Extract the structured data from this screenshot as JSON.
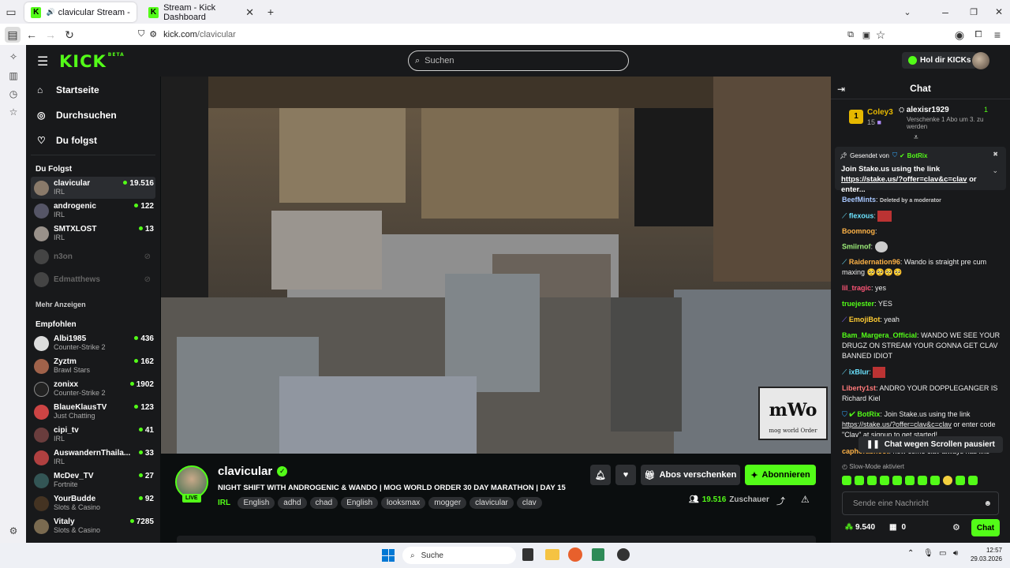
{
  "browser": {
    "tabs": [
      {
        "label": "clavicular Stream - Watch L"
      },
      {
        "label": "Stream - Kick Dashboard"
      }
    ],
    "url_host": "kick.com",
    "url_path": "/clavicular"
  },
  "topbar": {
    "logo": "KICK",
    "logo_badge": "BETA",
    "search_placeholder": "Suchen",
    "promo": "Hol dir KICKs"
  },
  "nav": {
    "items": [
      {
        "label": "Startseite",
        "icon": "home-icon"
      },
      {
        "label": "Durchsuchen",
        "icon": "compass-icon"
      },
      {
        "label": "Du folgst",
        "icon": "heart-icon"
      }
    ]
  },
  "followed": {
    "title": "Du Folgst",
    "more": "Mehr Anzeigen",
    "channels": [
      {
        "name": "clavicular",
        "category": "IRL",
        "viewers": "19.516",
        "selected": true
      },
      {
        "name": "androgenic",
        "category": "IRL",
        "viewers": "122"
      },
      {
        "name": "SMTXLOST",
        "category": "IRL",
        "viewers": "13"
      },
      {
        "name": "n3on",
        "category": "",
        "viewers": "",
        "offline": true
      },
      {
        "name": "Edmatthews",
        "category": "",
        "viewers": "",
        "offline": true
      }
    ]
  },
  "recommended": {
    "title": "Empfohlen",
    "channels": [
      {
        "name": "Albi1985",
        "category": "Counter-Strike 2",
        "viewers": "436"
      },
      {
        "name": "Zyztm",
        "category": "Brawl Stars",
        "viewers": "162"
      },
      {
        "name": "zonixx",
        "category": "Counter-Strike 2",
        "viewers": "1902"
      },
      {
        "name": "BlaueKlausTV",
        "category": "Just Chatting",
        "viewers": "123"
      },
      {
        "name": "cipi_tv",
        "category": "IRL",
        "viewers": "41"
      },
      {
        "name": "AuswandernThaila...",
        "category": "IRL",
        "viewers": "33"
      },
      {
        "name": "McDev_TV",
        "category": "Fortnite",
        "viewers": "27"
      },
      {
        "name": "YourBudde",
        "category": "Slots & Casino",
        "viewers": "92"
      },
      {
        "name": "Vitaly",
        "category": "Slots & Casino",
        "viewers": "7285"
      }
    ]
  },
  "stream": {
    "channel": "clavicular",
    "live": "LIVE",
    "title": "NIGHT SHIFT WITH ANDROGENIC & WANDO | MOG WORLD ORDER 30 DAY MARATHON | DAY 15",
    "category": "IRL",
    "tags": [
      "English",
      "adhd",
      "chad",
      "English",
      "looksmax",
      "mogger",
      "clavicular",
      "clav"
    ],
    "viewers": "19.516",
    "viewers_label": "Zuschauer",
    "gift_label": "Abos verschenken",
    "follow_label": "Abonnieren",
    "watermark_big": "mWo",
    "watermark_small": "mog world Order"
  },
  "chat": {
    "title": "Chat",
    "top_gifter": {
      "rank": "1",
      "name": "Coley3",
      "count": "15"
    },
    "gift_event": {
      "user": "alexisr1929",
      "count": "1",
      "text": "Verschenke 1 Abo um 3. zu werden"
    },
    "pinned": {
      "label": "Gesendet von",
      "user": "BotRix",
      "text": "Join Stake.us using the link ",
      "link": "https://stake.us/?offer=clav&c=clav",
      "suffix": " or enter..."
    },
    "messages": [
      {
        "user": "BeefMints",
        "color": "#a7c7ff",
        "text": "Deleted by a moderator"
      },
      {
        "user": "flexous",
        "color": "#6be3ff",
        "text": ""
      },
      {
        "user": "Boomnog",
        "color": "#ffb347",
        "text": ""
      },
      {
        "user": "Smiirnof",
        "color": "#9ef07a",
        "text": ""
      },
      {
        "user": "Raidernation96",
        "color": "#ffb347",
        "text": "Wando is straight pre cum maxing 🥺🥺🥺🥺"
      },
      {
        "user": "lil_tragic",
        "color": "#ff5577",
        "text": "yes"
      },
      {
        "user": "truejester",
        "color": "#53fc18",
        "text": "YES"
      },
      {
        "user": "EmojiBot",
        "color": "#ffcc33",
        "text": "yeah"
      },
      {
        "user": "Bam_Margera_Official",
        "color": "#53fc18",
        "text": "WANDO WE SEE YOUR DRUGZ ON STREAM YOUR GONNA GET CLAV BANNED IDIOT"
      },
      {
        "user": "ixBlur",
        "color": "#6be3ff",
        "text": ""
      },
      {
        "user": "Liberty1st",
        "color": "#ff7a7a",
        "text": "ANDRO YOUR DOPPLEGANGER IS Richard Kiel"
      },
      {
        "user": "BotRix",
        "color": "#53fc18",
        "text": "Join Stake.us using the link ",
        "link": "https://stake.us/?offer=clav&c=clav",
        "suffix": " or enter code \"Clav\" at signup to get started!"
      },
      {
        "user": "caphorasnoot",
        "color": "#ffb347",
        "text": "how come clav always has like"
      }
    ],
    "paused": "Chat wegen Scrollen pausiert",
    "slow_mode": "Slow-Mode aktiviert",
    "input_placeholder": "Sende eine Nachricht",
    "points": "9.540",
    "other_count": "0",
    "send_label": "Chat"
  },
  "taskbar": {
    "search": "Suche",
    "time": "12:57",
    "date": "29.03.2026"
  }
}
